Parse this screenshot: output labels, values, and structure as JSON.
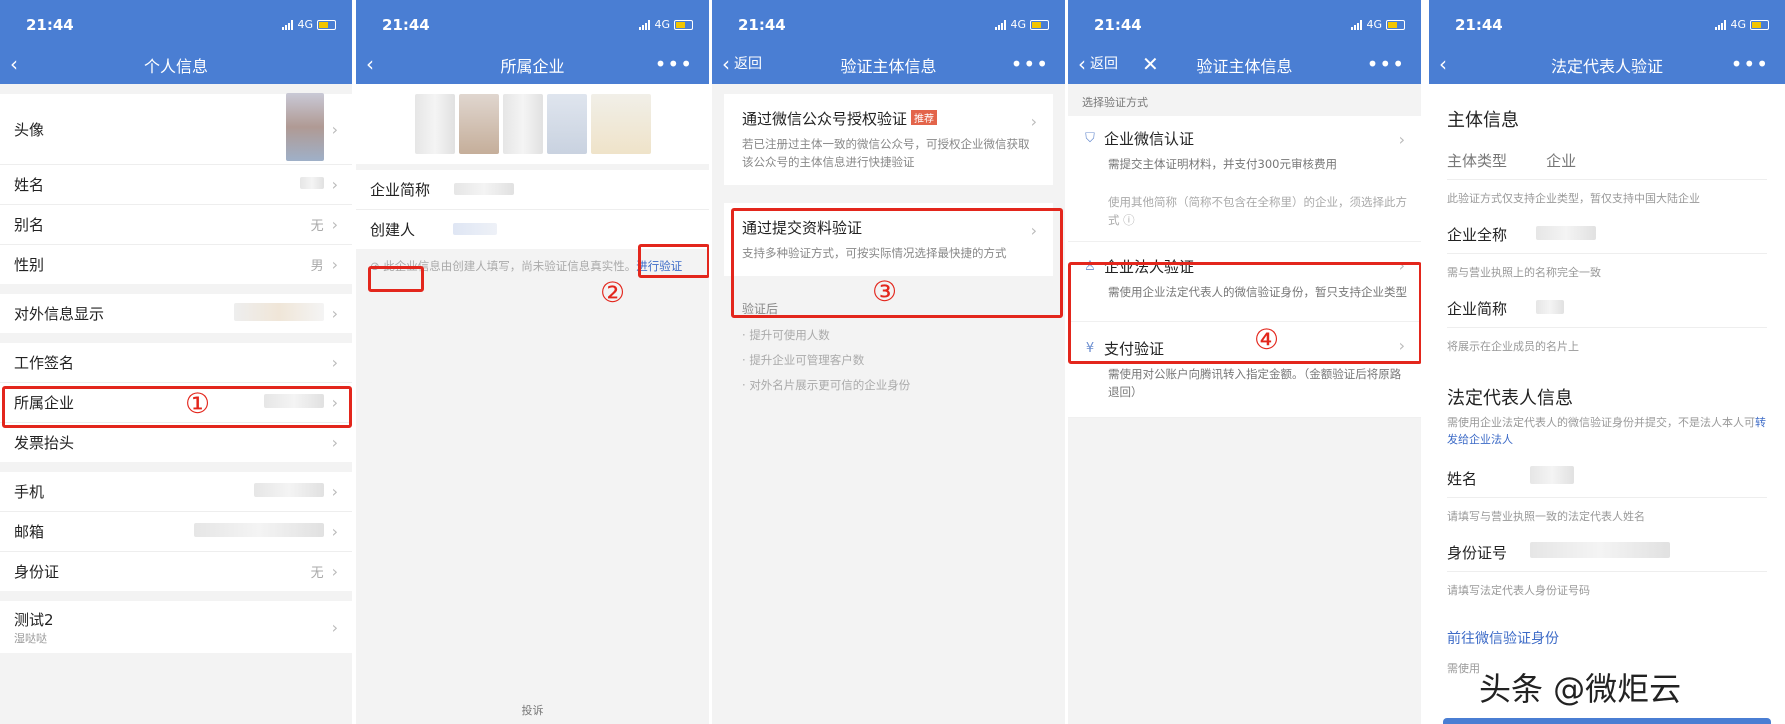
{
  "status": {
    "time": "21:44",
    "network": "4G"
  },
  "panel1": {
    "title": "个人信息",
    "rows": {
      "avatar": "头像",
      "name": "姓名",
      "alias": "别名",
      "alias_value": "无",
      "gender": "性别",
      "gender_value": "男",
      "external_info": "对外信息显示",
      "work_signature": "工作签名",
      "company": "所属企业",
      "invoice": "发票抬头",
      "phone": "手机",
      "email": "邮箱",
      "id_card": "身份证",
      "id_card_value": "无",
      "test_title": "测试2",
      "test_sub": "湿哒哒"
    },
    "step_number": "①"
  },
  "panel2": {
    "title": "所属企业",
    "short_name_label": "企业简称",
    "creator_label": "创建人",
    "notice": "此企业信息由创建人填写，尚未验证信息真实性。",
    "verify_link": "进行验证",
    "complaint": "投诉",
    "step_number": "②"
  },
  "panel3": {
    "back_label": "返回",
    "title": "验证主体信息",
    "option1_title": "通过微信公众号授权验证",
    "option1_tag": "推荐",
    "option1_desc": "若已注册过主体一致的微信公众号，可授权企业微信获取该公众号的主体信息进行快捷验证",
    "option2_title": "通过提交资料验证",
    "option2_desc": "支持多种验证方式，可按实际情况选择最快捷的方式",
    "after_title": "验证后",
    "after_items": [
      "提升可使用人数",
      "提升企业可管理客户数",
      "对外名片展示更可信的企业身份"
    ],
    "step_number": "③"
  },
  "panel4": {
    "back_label": "返回",
    "title": "验证主体信息",
    "section_label": "选择验证方式",
    "opt1_title": "企业微信认证",
    "opt1_desc": "需提交主体证明材料，并支付300元审核费用",
    "opt1_note": "使用其他简称（简称不包含在全称里）的企业，须选择此方式",
    "opt2_title": "企业法人验证",
    "opt2_desc": "需使用企业法定代表人的微信验证身份，暂只支持企业类型",
    "opt3_title": "支付验证",
    "opt3_desc": "需使用对公账户向腾讯转入指定金额。（金额验证后将原路退回）",
    "step_number": "④"
  },
  "panel5": {
    "title": "法定代表人验证",
    "subject_heading": "主体信息",
    "subject_type_label": "主体类型",
    "subject_type_value": "企业",
    "subject_type_hint": "此验证方式仅支持企业类型，暂仅支持中国大陆企业",
    "full_name_label": "企业全称",
    "full_name_hint": "需与营业执照上的名称完全一致",
    "short_name_label": "企业简称",
    "short_name_hint": "将展示在企业成员的名片上",
    "legal_heading": "法定代表人信息",
    "legal_desc": "需使用企业法定代表人的微信验证身份并提交，不是法人本人可",
    "legal_link": "转发给企业法人",
    "name_label": "姓名",
    "name_hint": "请填写与营业执照一致的法定代表人姓名",
    "id_label": "身份证号",
    "id_hint": "请填写法定代表人身份证号码",
    "wechat_verify_link": "前往微信验证身份",
    "footer_hint": "需使用",
    "watermark": "头条 @微炬云"
  }
}
